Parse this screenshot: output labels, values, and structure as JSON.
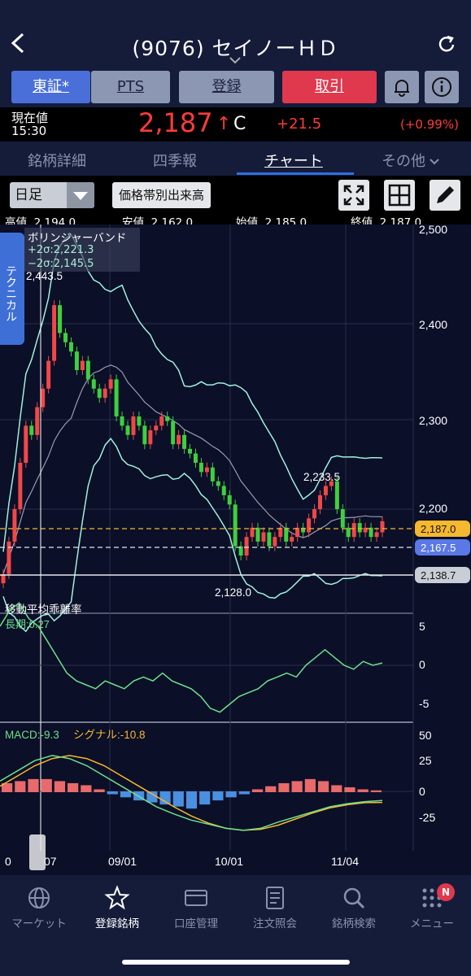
{
  "header": {
    "title": "(9076) セイノーＨＤ"
  },
  "buttons": {
    "tsho": "東証*",
    "pts": "PTS",
    "register": "登録",
    "trade": "取引"
  },
  "icons": [
    "back-arrow-icon",
    "chevron-down-icon",
    "refresh-icon",
    "bell-icon",
    "info-icon",
    "fullscreen-icon",
    "grid-icon",
    "pencil-icon"
  ],
  "price": {
    "label": "現在値",
    "time": "15:30",
    "value": "2,187",
    "arrow": "↑",
    "flag": "C",
    "change": "+21.5",
    "change_pct": "(+0.99%)"
  },
  "tabs": [
    {
      "label": "銘柄詳細"
    },
    {
      "label": "四季報"
    },
    {
      "label": "チャート",
      "active": true
    },
    {
      "label": "その他"
    }
  ],
  "controls": {
    "period": "日足",
    "volume_btn": "価格帯別出来高"
  },
  "ohlc": {
    "high_label": "高値",
    "high": "2,194.0",
    "low_label": "安値",
    "low": "2,162.0",
    "open_label": "始値",
    "open": "2,185.0",
    "close_label": "終値",
    "close": "2,187.0"
  },
  "side_tab": "テクニカル",
  "legend": {
    "title": "ボリンジャーバンド",
    "upper": "+2σ:2,221.3",
    "lower": "−2σ:2,145.5"
  },
  "chart_data": {
    "type": "candlestick",
    "y_axis_ticks": [
      "2,500",
      "2,400",
      "2,300",
      "2,200"
    ],
    "x_axis_ticks": [
      "0",
      "07",
      "09/01",
      "10/01",
      "11/04"
    ],
    "price_tags": [
      {
        "label": "2,187.0",
        "color": "#f5b82e"
      },
      {
        "label": "2,167.5",
        "color": "#5a78e6"
      },
      {
        "label": "2,138.7",
        "color": "#c9ced6"
      }
    ],
    "annotations": [
      "2,443.5",
      "2,233.5",
      "2,128.0"
    ],
    "closes": [
      2130,
      2165,
      2200,
      2250,
      2290,
      2280,
      2310,
      2330,
      2360,
      2420,
      2390,
      2380,
      2370,
      2350,
      2360,
      2340,
      2330,
      2320,
      2330,
      2340,
      2300,
      2290,
      2280,
      2300,
      2290,
      2270,
      2285,
      2290,
      2300,
      2295,
      2270,
      2280,
      2265,
      2260,
      2250,
      2240,
      2245,
      2230,
      2225,
      2215,
      2205,
      2160,
      2150,
      2170,
      2180,
      2165,
      2175,
      2160,
      2170,
      2180,
      2165,
      2170,
      2180,
      2175,
      2190,
      2200,
      2215,
      2225,
      2230,
      2200,
      2180,
      2170,
      2185,
      2175,
      2180,
      2170,
      2175,
      2187
    ],
    "deviation": {
      "title": "移動平均乖離率",
      "long_label": "長期:0.27",
      "y_ticks": [
        "5",
        "0",
        "-5"
      ],
      "values": [
        5,
        7,
        8,
        6,
        5,
        3,
        1,
        -1,
        -2,
        -2.5,
        -3,
        -2,
        -2.5,
        -3,
        -2,
        -1.5,
        -2,
        -1,
        -2,
        -2.5,
        -3,
        -4,
        -5.5,
        -6,
        -5,
        -4,
        -3.5,
        -3,
        -2,
        -1.5,
        -1,
        -1.5,
        0,
        1,
        2,
        1,
        0,
        -0.5,
        0.5,
        0,
        0.3
      ]
    },
    "macd": {
      "macd_label": "MACD:-9.3",
      "signal_label": "シグナル:-10.8",
      "y_ticks": [
        "50",
        "25",
        "0",
        "-25"
      ],
      "macd": [
        10,
        20,
        30,
        35,
        32,
        25,
        15,
        5,
        -5,
        -15,
        -22,
        -28,
        -32,
        -36,
        -38,
        -36,
        -30,
        -25,
        -20,
        -15,
        -12,
        -10,
        -9
      ],
      "signal": [
        5,
        15,
        25,
        32,
        35,
        32,
        25,
        15,
        5,
        -5,
        -15,
        -24,
        -31,
        -36,
        -38,
        -37,
        -33,
        -27,
        -21,
        -16,
        -13,
        -11,
        -10.8
      ],
      "histogram": [
        8,
        10,
        12,
        12,
        10,
        8,
        6,
        2,
        -2,
        -5,
        -8,
        -10,
        -12,
        -14,
        -16,
        -12,
        -8,
        -5,
        -2,
        2,
        5,
        8,
        10,
        12,
        10,
        6,
        4,
        2,
        1
      ]
    }
  },
  "bottom_nav": [
    {
      "label": "マーケット"
    },
    {
      "label": "登録銘柄",
      "active": true
    },
    {
      "label": "口座管理"
    },
    {
      "label": "注文照会"
    },
    {
      "label": "銘柄検索"
    },
    {
      "label": "メニュー",
      "badge": "N"
    }
  ]
}
